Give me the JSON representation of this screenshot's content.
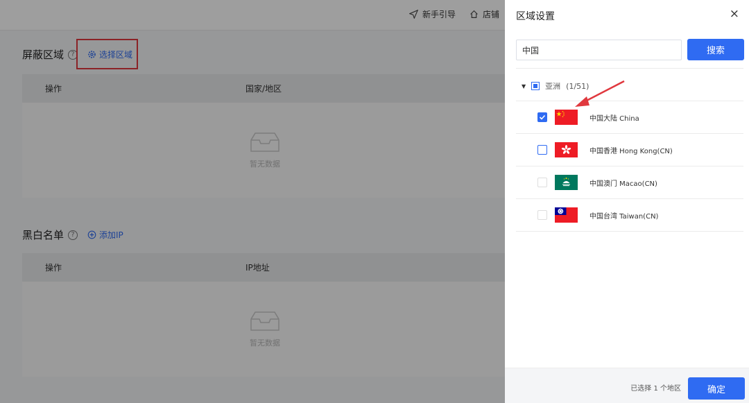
{
  "topbar": {
    "links": [
      {
        "label": "新手引导",
        "icon": "send-icon"
      },
      {
        "label": "店铺",
        "icon": "home-icon"
      }
    ]
  },
  "blocked_regions": {
    "title": "屏蔽区域",
    "help_glyph": "?",
    "action_label": "选择区域",
    "action_icon": "gear-icon",
    "columns": [
      "操作",
      "国家/地区"
    ],
    "empty_text": "暂无数据"
  },
  "blacklist": {
    "title": "黑白名单",
    "help_glyph": "?",
    "action_label": "添加IP",
    "action_icon": "plus-circle-icon",
    "columns": [
      "操作",
      "IP地址"
    ],
    "empty_text": "暂无数据"
  },
  "drawer": {
    "title": "区域设置",
    "close_glyph": "×",
    "search_value": "中国",
    "search_button": "搜索",
    "group": {
      "name": "亚洲",
      "count": "(1/51)",
      "state": "partial"
    },
    "regions": [
      {
        "name": "中国大陆 China",
        "checked": true,
        "flag": "cn-flag"
      },
      {
        "name": "中国香港 Hong Kong(CN)",
        "checked": false,
        "flag": "hk-flag"
      },
      {
        "name": "中国澳门 Macao(CN)",
        "checked": false,
        "flag": "mo-flag"
      },
      {
        "name": "中国台湾 Taiwan(CN)",
        "checked": false,
        "flag": "tw-flag"
      }
    ],
    "selected_text": "已选择 1 个地区",
    "confirm_button": "确定"
  },
  "colors": {
    "primary": "#2f6bf2",
    "annotation": "#e0383e",
    "flag_red": "#ee1c25",
    "flag_green": "#00785e",
    "flag_blue": "#000095"
  }
}
